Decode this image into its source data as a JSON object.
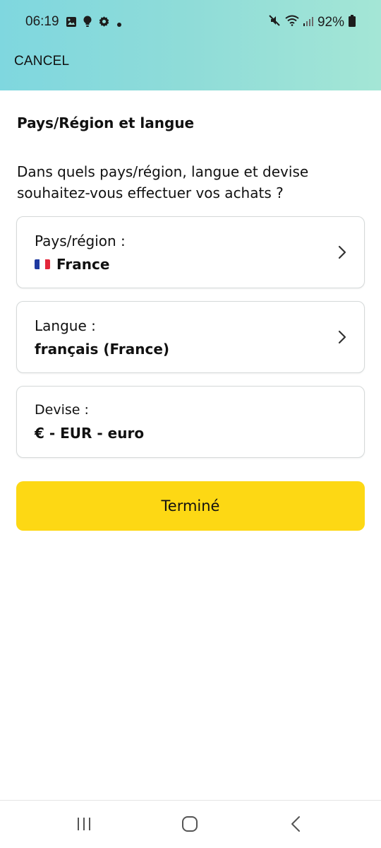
{
  "status_bar": {
    "time": "06:19",
    "battery": "92%",
    "left_icons": [
      "gallery-icon",
      "lightbulb-icon",
      "gear-icon",
      "dot-icon"
    ],
    "right_icons": [
      "mute-icon",
      "wifi-icon",
      "signal-icon",
      "battery-icon"
    ]
  },
  "header": {
    "cancel_label": "CANCEL",
    "gradient_colors": [
      "#7fd7df",
      "#a4e6d6"
    ]
  },
  "page": {
    "title": "Pays/Région et langue",
    "intro_line1": "Dans quels pays/région, langue et devise",
    "intro_line2": "souhaitez-vous effectuer vos achats ?"
  },
  "settings": [
    {
      "label": "Pays/région :",
      "value": "France",
      "has_flag": true,
      "has_chevron": true
    },
    {
      "label": "Langue :",
      "value": "français (France)",
      "has_flag": false,
      "has_chevron": true
    },
    {
      "label": "Devise :",
      "value": "€ - EUR - euro",
      "has_flag": false,
      "has_chevron": false
    }
  ],
  "actions": {
    "done_label": "Terminé",
    "done_color": "#fdd814"
  },
  "nav_bar": {
    "buttons": [
      "recent-apps-icon",
      "home-icon",
      "back-icon"
    ]
  }
}
